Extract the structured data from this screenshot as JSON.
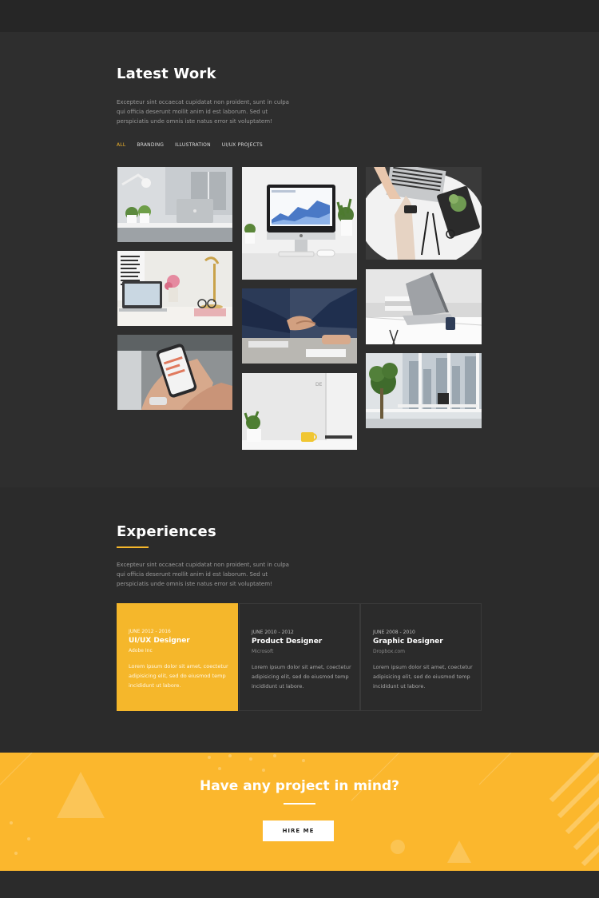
{
  "latest_work": {
    "title": "Latest Work",
    "paragraph": "Excepteur sint occaecat cupidatat non proident, sunt in culpa qui officia deserunt mollit anim id est laborum. Sed ut perspiciatis unde omnis iste natus error sit voluptatem!",
    "filters": [
      "ALL",
      "BRANDING",
      "ILLUSTRATION",
      "UI/UX PROJECTS"
    ],
    "active_filter": "ALL"
  },
  "experiences": {
    "title": "Experiences",
    "paragraph": "Excepteur sint occaecat cupidatat non proident, sunt in culpa qui officia deserunt mollit anim id est laborum. Sed ut perspiciatis unde omnis iste natus error sit voluptatem!",
    "items": [
      {
        "date": "JUNE 2012 - 2016",
        "role": "UI/UX Designer",
        "company": "Adobe Inc",
        "description": "Lorem ipsum dolor sit amet, coectetur adipisicing elit, sed do eiusmod temp incididunt ut labore."
      },
      {
        "date": "JUNE 2010 - 2012",
        "role": "Product Designer",
        "company": "Microsoft",
        "description": "Lorem ipsum dolor sit amet, coectetur adipisicing elit, sed do eiusmod temp incididunt ut labore."
      },
      {
        "date": "JUNE 2008 - 2010",
        "role": "Graphic Designer",
        "company": "Dropbox.com",
        "description": "Lorem ipsum dolor sit amet, coectetur adipisicing elit, sed do eiusmod temp incididunt ut labore."
      }
    ]
  },
  "cta": {
    "title": "Have any project in mind?",
    "button_label": "HIRE ME"
  },
  "colors": {
    "accent": "#fbb72d",
    "background": "#2b2b2b"
  }
}
